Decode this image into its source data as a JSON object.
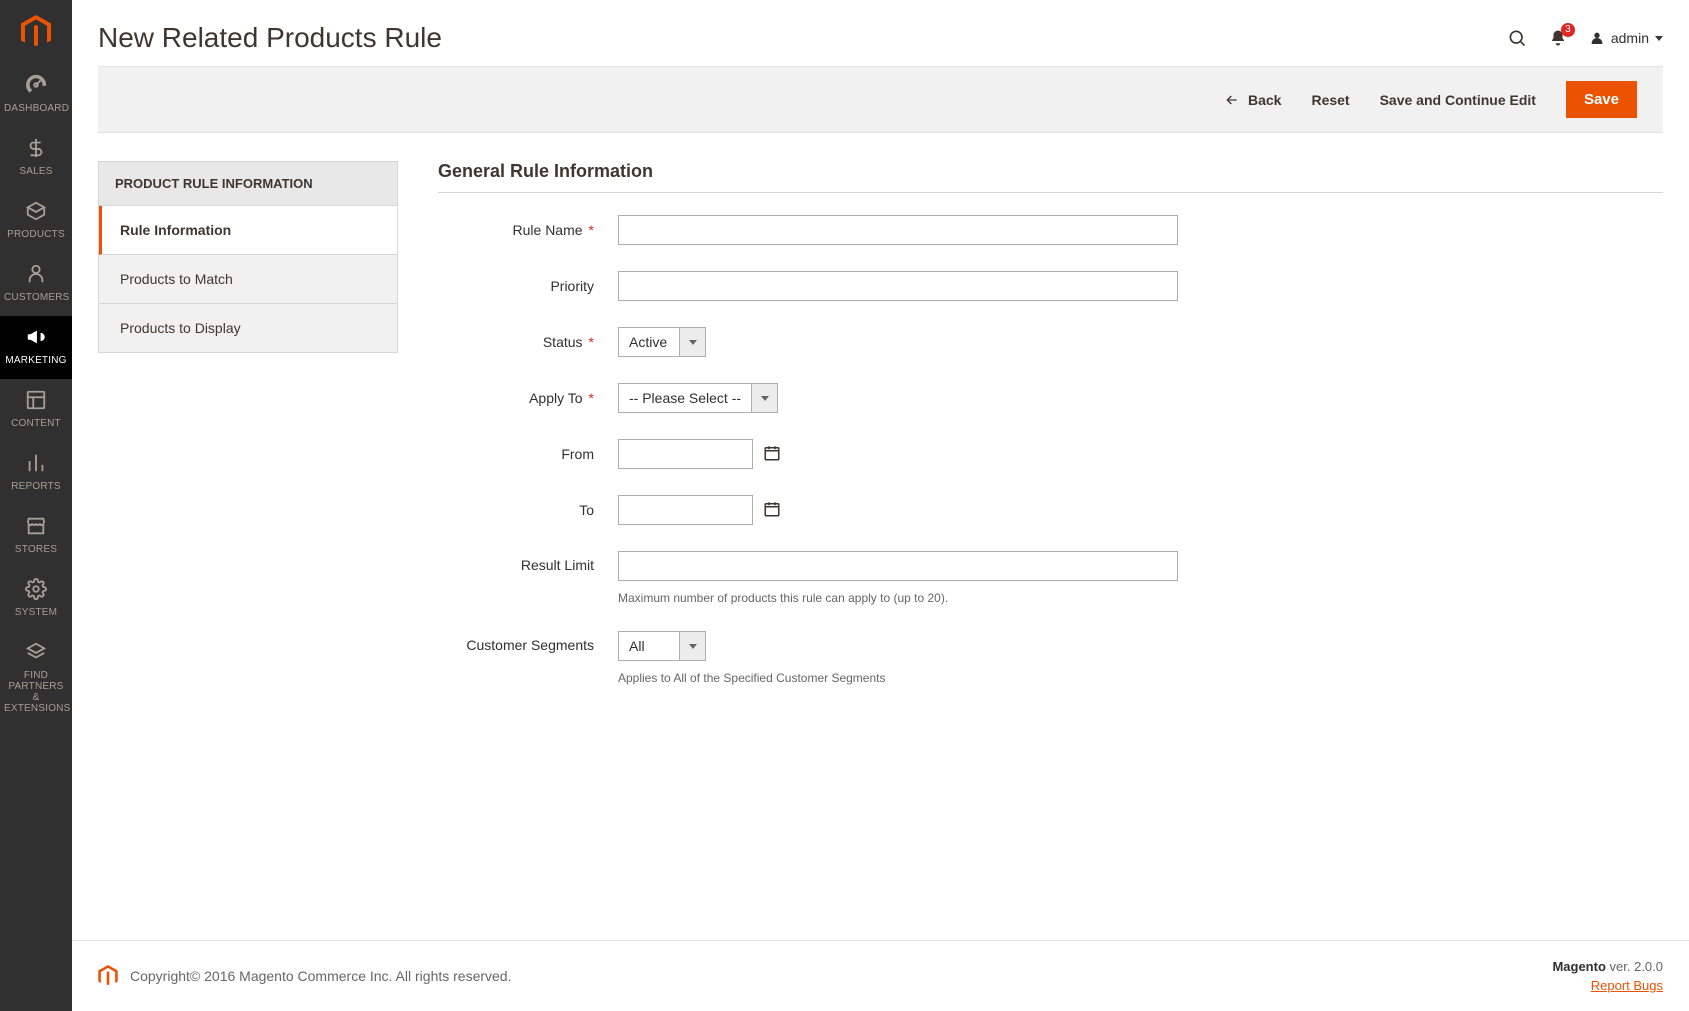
{
  "nav": {
    "items": [
      {
        "id": "dashboard",
        "label": "DASHBOARD"
      },
      {
        "id": "sales",
        "label": "SALES"
      },
      {
        "id": "products",
        "label": "PRODUCTS"
      },
      {
        "id": "customers",
        "label": "CUSTOMERS"
      },
      {
        "id": "marketing",
        "label": "MARKETING"
      },
      {
        "id": "content",
        "label": "CONTENT"
      },
      {
        "id": "reports",
        "label": "REPORTS"
      },
      {
        "id": "stores",
        "label": "STORES"
      },
      {
        "id": "system",
        "label": "SYSTEM"
      },
      {
        "id": "find_partners",
        "label": "FIND PARTNERS & EXTENSIONS"
      }
    ]
  },
  "header": {
    "title": "New Related Products Rule",
    "notifications_count": "3",
    "admin_label": "admin"
  },
  "actions": {
    "back": "Back",
    "reset": "Reset",
    "save_continue": "Save and Continue Edit",
    "save": "Save"
  },
  "side_tabs": {
    "title": "PRODUCT RULE INFORMATION",
    "items": [
      {
        "label": "Rule Information"
      },
      {
        "label": "Products to Match"
      },
      {
        "label": "Products to Display"
      }
    ]
  },
  "form": {
    "legend": "General Rule Information",
    "rule_name": {
      "label": "Rule Name",
      "value": ""
    },
    "priority": {
      "label": "Priority",
      "value": ""
    },
    "status": {
      "label": "Status",
      "value": "Active"
    },
    "apply_to": {
      "label": "Apply To",
      "value": "-- Please Select --"
    },
    "from": {
      "label": "From",
      "value": ""
    },
    "to": {
      "label": "To",
      "value": ""
    },
    "result_limit": {
      "label": "Result Limit",
      "value": "",
      "note": "Maximum number of products this rule can apply to (up to 20)."
    },
    "customer_segments": {
      "label": "Customer Segments",
      "value": "All",
      "note": "Applies to All of the Specified Customer Segments"
    }
  },
  "footer": {
    "copyright": "Copyright© 2016 Magento Commerce Inc. All rights reserved.",
    "version_label": "Magento",
    "version_suffix": " ver. 2.0.0",
    "report_bugs": "Report Bugs"
  },
  "colors": {
    "accent": "#eb5202",
    "danger": "#e22626"
  }
}
